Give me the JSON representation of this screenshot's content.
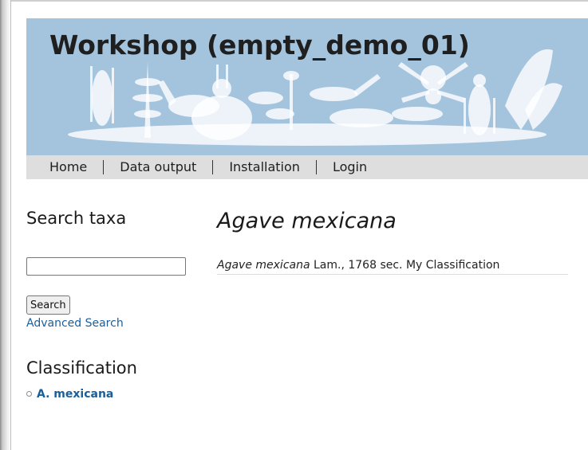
{
  "site": {
    "title": "Workshop (empty_demo_01)"
  },
  "nav": {
    "items": [
      "Home",
      "Data output",
      "Installation",
      "Login"
    ]
  },
  "sidebar": {
    "search_heading": "Search taxa",
    "search_input_value": "",
    "search_button_label": "Search",
    "advanced_search_label": "Advanced Search",
    "classification_heading": "Classification",
    "tree_items": [
      "A. mexicana"
    ]
  },
  "main": {
    "title": "Agave mexicana",
    "name": "Agave mexicana",
    "authorship_and_source": "Lam., 1768 sec. My Classification"
  },
  "colors": {
    "banner_bg": "#a4c4de",
    "navbar_bg": "#dedede",
    "link": "#1b5e9a",
    "silhouettes": "#ffffff"
  }
}
